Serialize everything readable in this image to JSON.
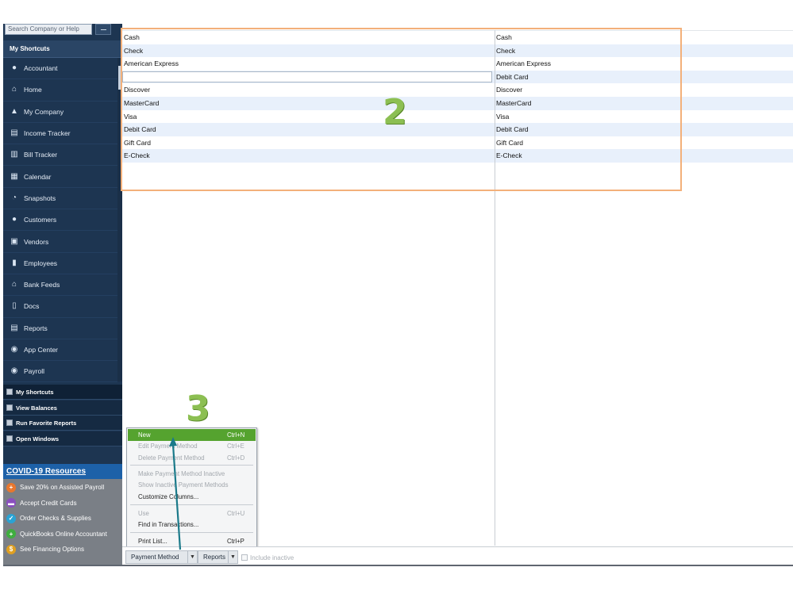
{
  "search": {
    "placeholder": "Search Company or Help"
  },
  "nav": {
    "header": "My Shortcuts",
    "items": [
      {
        "label": "Accountant",
        "icon": "user-icon"
      },
      {
        "label": "Home",
        "icon": "home-icon"
      },
      {
        "label": "My Company",
        "icon": "company-icon"
      },
      {
        "label": "Income Tracker",
        "icon": "income-tracker-icon"
      },
      {
        "label": "Bill Tracker",
        "icon": "bill-tracker-icon"
      },
      {
        "label": "Calendar",
        "icon": "calendar-icon"
      },
      {
        "label": "Snapshots",
        "icon": "pie-chart-icon"
      },
      {
        "label": "Customers",
        "icon": "customer-icon"
      },
      {
        "label": "Vendors",
        "icon": "vendor-icon"
      },
      {
        "label": "Employees",
        "icon": "employee-icon"
      },
      {
        "label": "Bank Feeds",
        "icon": "bank-icon"
      },
      {
        "label": "Docs",
        "icon": "document-icon"
      },
      {
        "label": "Reports",
        "icon": "report-icon"
      },
      {
        "label": "App Center",
        "icon": "app-center-icon"
      },
      {
        "label": "Payroll",
        "icon": "payroll-icon"
      }
    ]
  },
  "sections": {
    "my_shortcuts": "My Shortcuts",
    "view_balances": "View Balances",
    "run_favorite_reports": "Run Favorite Reports",
    "open_windows": "Open Windows"
  },
  "covid": {
    "header": "COVID-19 Resources",
    "items": [
      {
        "label": "Save 20% on Assisted Payroll",
        "icon": "plus-icon",
        "color": "#e8772e"
      },
      {
        "label": "Accept Credit Cards",
        "icon": "credit-card-icon",
        "color": "#8a4fbf"
      },
      {
        "label": "Order Checks & Supplies",
        "icon": "checks-icon",
        "color": "#2aa3d4"
      },
      {
        "label": "QuickBooks Online Accountant",
        "icon": "plus-icon",
        "color": "#3fae3f"
      },
      {
        "label": "See Financing Options",
        "icon": "dollar-icon",
        "color": "#e0a021"
      }
    ]
  },
  "list": {
    "rows": [
      {
        "name": "Cash",
        "type": "Cash"
      },
      {
        "name": "Check",
        "type": "Check"
      },
      {
        "name": "American Express",
        "type": "American Express"
      },
      {
        "name": "",
        "type": "Debit Card"
      },
      {
        "name": "Discover",
        "type": "Discover"
      },
      {
        "name": "MasterCard",
        "type": "MasterCard"
      },
      {
        "name": "Visa",
        "type": "Visa"
      },
      {
        "name": "Debit Card",
        "type": "Debit Card"
      },
      {
        "name": "Gift Card",
        "type": "Gift Card"
      },
      {
        "name": "E-Check",
        "type": "E-Check"
      }
    ]
  },
  "annotations": {
    "step2": "2",
    "step3": "3",
    "box_color": "#f3b07a",
    "number_color": "#8cbf52",
    "arrow_color": "#1b7a8a"
  },
  "menu": {
    "items": [
      {
        "label": "New",
        "shortcut": "Ctrl+N",
        "state": "selected"
      },
      {
        "label": "Edit Payment Method",
        "shortcut": "Ctrl+E",
        "state": "disabled"
      },
      {
        "label": "Delete Payment Method",
        "shortcut": "Ctrl+D",
        "state": "disabled"
      },
      {
        "label": "Make Payment Method Inactive",
        "shortcut": "",
        "state": "disabled"
      },
      {
        "label": "Show Inactive Payment Methods",
        "shortcut": "",
        "state": "disabled"
      },
      {
        "label": "Customize Columns...",
        "shortcut": "",
        "state": "enabled"
      },
      {
        "label": "Use",
        "shortcut": "Ctrl+U",
        "state": "disabled"
      },
      {
        "label": "Find in Transactions...",
        "shortcut": "",
        "state": "enabled"
      },
      {
        "label": "Print List...",
        "shortcut": "Ctrl+P",
        "state": "enabled"
      }
    ]
  },
  "toolbar": {
    "payment_method": "Payment Method",
    "reports": "Reports",
    "include_inactive": "Include inactive"
  }
}
